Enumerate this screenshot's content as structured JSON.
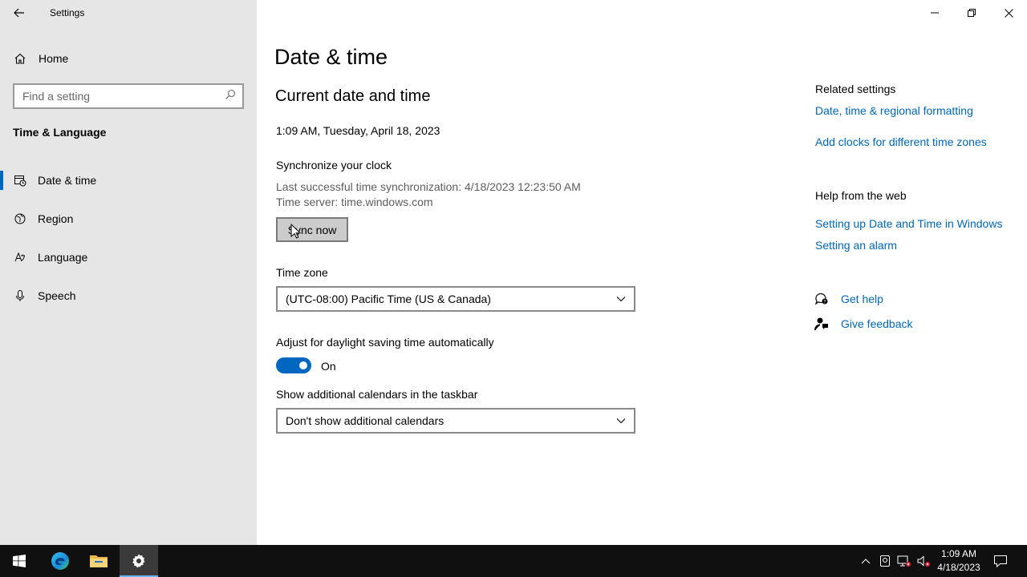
{
  "window": {
    "title": "Settings"
  },
  "sidebar": {
    "home_label": "Home",
    "search_placeholder": "Find a setting",
    "section_title": "Time & Language",
    "items": [
      {
        "label": "Date & time",
        "icon": "date-time-icon",
        "active": true
      },
      {
        "label": "Region",
        "icon": "globe-icon",
        "active": false
      },
      {
        "label": "Language",
        "icon": "language-icon",
        "active": false
      },
      {
        "label": "Speech",
        "icon": "microphone-icon",
        "active": false
      }
    ]
  },
  "main": {
    "page_title": "Date & time",
    "section_title": "Current date and time",
    "current_datetime": "1:09 AM, Tuesday, April 18, 2023",
    "sync": {
      "heading": "Synchronize your clock",
      "last_sync": "Last successful time synchronization: 4/18/2023 12:23:50 AM",
      "server": "Time server: time.windows.com",
      "button_label": "Sync now"
    },
    "timezone": {
      "label": "Time zone",
      "value": "(UTC-08:00) Pacific Time (US & Canada)"
    },
    "dst": {
      "label": "Adjust for daylight saving time automatically",
      "state_label": "On",
      "on": true
    },
    "calendars": {
      "label": "Show additional calendars in the taskbar",
      "value": "Don't show additional calendars"
    }
  },
  "right": {
    "related_heading": "Related settings",
    "related_links": [
      "Date, time & regional formatting",
      "Add clocks for different time zones"
    ],
    "web_heading": "Help from the web",
    "web_links": [
      "Setting up Date and Time in Windows",
      "Setting an alarm"
    ],
    "get_help": "Get help",
    "give_feedback": "Give feedback"
  },
  "taskbar": {
    "time": "1:09 AM",
    "date": "4/18/2023"
  },
  "colors": {
    "accent": "#0067c0",
    "link": "#0067b8",
    "sidebar_bg": "#e6e6e6",
    "taskbar_bg": "#101010"
  }
}
